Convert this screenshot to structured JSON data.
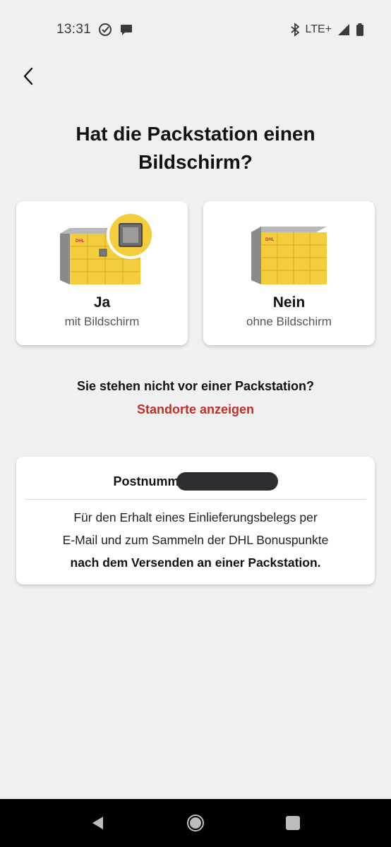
{
  "status_bar": {
    "time": "13:31",
    "network": "LTE+",
    "icons": [
      "check-circle-icon",
      "chat-bubble-icon",
      "bluetooth-icon",
      "signal-icon",
      "battery-icon"
    ]
  },
  "header": {
    "back_icon": "chevron-left-icon"
  },
  "title": "Hat die Packstation einen Bildschirm?",
  "options": [
    {
      "label": "Ja",
      "sublabel": "mit Bildschirm",
      "illustration": "packstation-with-screen"
    },
    {
      "label": "Nein",
      "sublabel": "ohne Bildschirm",
      "illustration": "packstation-without-screen"
    }
  ],
  "not_at_station_text": "Sie stehen nicht vor einer Packstation?",
  "show_locations_link": "Standorte anzeigen",
  "info_card": {
    "postnum_label": "Postnumm",
    "line1": "Für den Erhalt eines Einlieferungsbelegs per",
    "line2": "E-Mail und zum Sammeln der DHL Bonuspunkte",
    "line3_bold": "nach dem Versenden an einer Packstation."
  },
  "colors": {
    "accent_red": "#c0302a",
    "dhl_yellow": "#f4cd3c",
    "background": "#f0f0f0"
  },
  "nav_bar": {
    "icons": [
      "back-triangle-icon",
      "home-circle-icon",
      "recents-square-icon"
    ]
  }
}
